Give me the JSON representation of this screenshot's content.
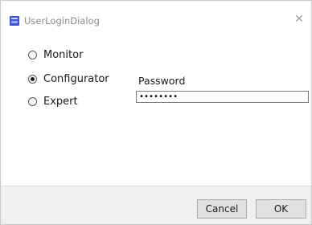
{
  "window": {
    "title": "UserLoginDialog",
    "icon": "app-icon",
    "close_icon": "close-icon",
    "close_glyph": "✕"
  },
  "roles": {
    "options": [
      {
        "label": "Monitor",
        "checked": false
      },
      {
        "label": "Configurator",
        "checked": true
      },
      {
        "label": "Expert",
        "checked": false
      }
    ]
  },
  "password": {
    "label": "Password",
    "masked_value": "••••••••"
  },
  "footer": {
    "cancel_label": "Cancel",
    "ok_label": "OK"
  },
  "colors": {
    "accent_icon": "#3b52d9",
    "footer_bg": "#f0f0f0",
    "button_bg": "#e1e1e1"
  }
}
